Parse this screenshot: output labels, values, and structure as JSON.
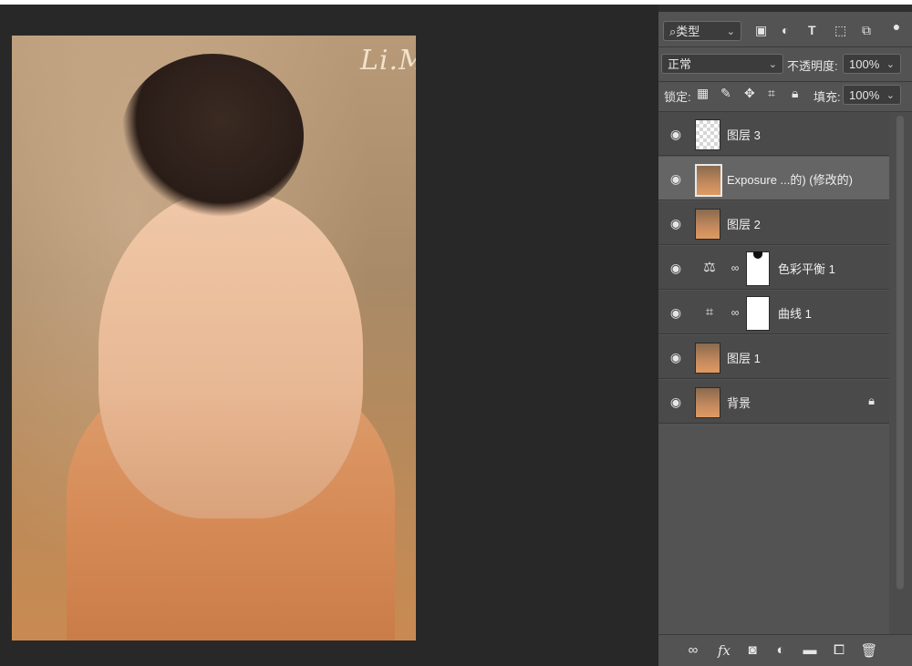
{
  "document": {
    "signature": "Li.M."
  },
  "layers_panel": {
    "filter": {
      "label": "类型"
    },
    "blend": {
      "mode": "正常",
      "opacity_label": "不透明度:",
      "opacity_value": "100%"
    },
    "lock": {
      "label": "锁定:",
      "fill_label": "填充:",
      "fill_value": "100%"
    },
    "layers": [
      {
        "name": "图层 3",
        "type": "pixel-transparent",
        "selected": false
      },
      {
        "name": "Exposure ...的) (修改的)",
        "type": "smart-object",
        "selected": true
      },
      {
        "name": "图层 2",
        "type": "pixel",
        "selected": false
      },
      {
        "name": "色彩平衡 1",
        "type": "adjustment-color-balance",
        "selected": false
      },
      {
        "name": "曲线 1",
        "type": "adjustment-curves",
        "selected": false
      },
      {
        "name": "图层 1",
        "type": "pixel",
        "selected": false
      },
      {
        "name": "背景",
        "type": "background",
        "selected": false,
        "locked": true
      }
    ],
    "colors": {
      "panel_bg": "#535353",
      "layer_bg": "#4a4a4a",
      "selected_bg": "#656565",
      "canvas_bg": "#282828"
    }
  }
}
